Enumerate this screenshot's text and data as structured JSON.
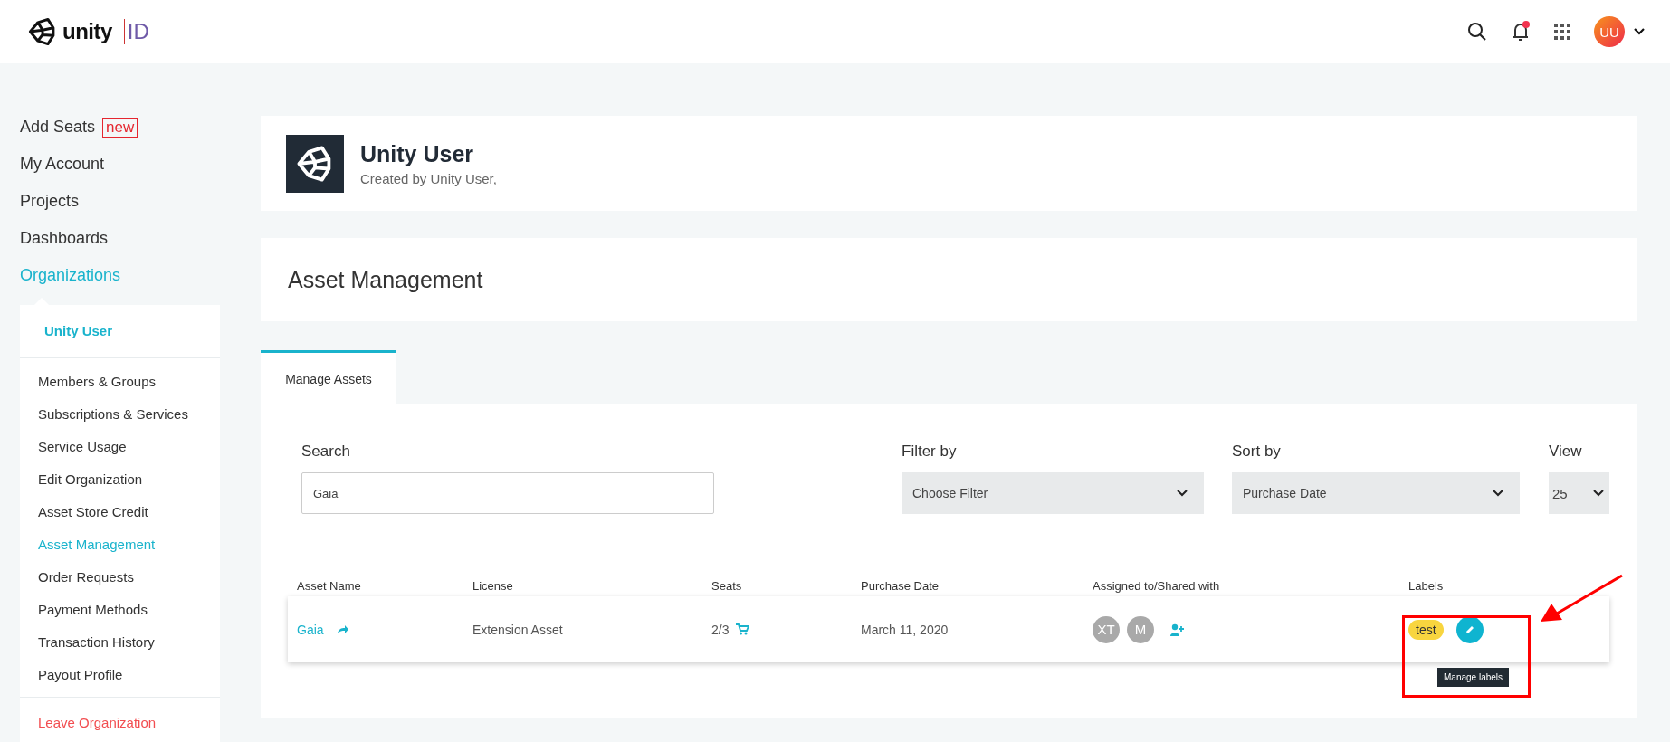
{
  "header": {
    "logo_text": "unity",
    "logo_suffix": "ID",
    "notification": true,
    "avatar_initials": "UU"
  },
  "sidebar": {
    "items": [
      {
        "label": "Add Seats",
        "badge": "new",
        "selected": false
      },
      {
        "label": "My Account",
        "selected": false
      },
      {
        "label": "Projects",
        "selected": false
      },
      {
        "label": "Dashboards",
        "selected": false
      },
      {
        "label": "Organizations",
        "selected": true
      }
    ],
    "org_menu": {
      "title": "Unity User",
      "items": [
        {
          "label": "Members & Groups",
          "selected": false
        },
        {
          "label": "Subscriptions & Services",
          "selected": false
        },
        {
          "label": "Service Usage",
          "selected": false
        },
        {
          "label": "Edit Organization",
          "selected": false
        },
        {
          "label": "Asset Store Credit",
          "selected": false
        },
        {
          "label": "Asset Management",
          "selected": true
        },
        {
          "label": "Order Requests",
          "selected": false
        },
        {
          "label": "Payment Methods",
          "selected": false
        },
        {
          "label": "Transaction History",
          "selected": false
        },
        {
          "label": "Payout Profile",
          "selected": false
        }
      ],
      "leave": "Leave Organization"
    }
  },
  "profile": {
    "name": "Unity User",
    "subtitle": "Created by Unity User,"
  },
  "page_title": "Asset Management",
  "tabs": [
    {
      "label": "Manage Assets",
      "selected": true
    }
  ],
  "filters": {
    "search": {
      "label": "Search",
      "value": "Gaia"
    },
    "filter_by": {
      "label": "Filter by",
      "value": "Choose Filter"
    },
    "sort_by": {
      "label": "Sort by",
      "value": "Purchase Date"
    },
    "view": {
      "label": "View",
      "value": "25"
    }
  },
  "table": {
    "columns": [
      "Asset Name",
      "License",
      "Seats",
      "Purchase Date",
      "Assigned to/Shared with",
      "Labels"
    ],
    "rows": [
      {
        "asset_name": "Gaia",
        "license": "Extension Asset",
        "seats": "2/3",
        "purchase_date": "March 11, 2020",
        "assigned": [
          "XT",
          "M"
        ],
        "labels": [
          "test"
        ]
      }
    ]
  },
  "tooltip": "Manage labels"
}
